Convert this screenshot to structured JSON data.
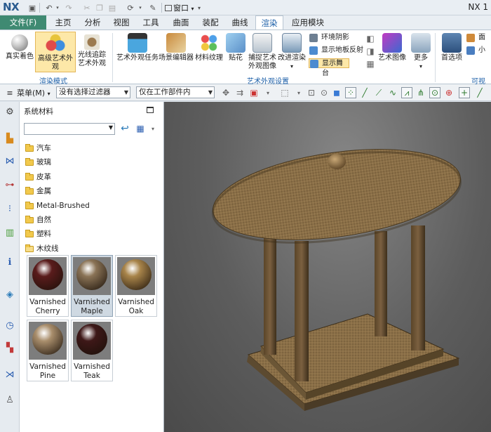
{
  "app": {
    "logo": "NX",
    "version_fragment": "NX 1"
  },
  "title_bar": {
    "window_menu": "窗口",
    "window_menu_arrow": "▾"
  },
  "tabs": {
    "file": "文件(F)",
    "items": [
      "主页",
      "分析",
      "视图",
      "工具",
      "曲面",
      "装配",
      "曲线",
      "渲染",
      "应用模块"
    ],
    "active": "渲染"
  },
  "ribbon": {
    "buttons": {
      "true_shading": "真实着色",
      "advanced_studio": "高级艺术外观",
      "raytrace_line1": "光线追踪",
      "raytrace_line2": "艺术外观",
      "studio_task": "艺术外观任务",
      "scene_editor": "场景编辑器",
      "material_texture": "材料纹理",
      "decal": "贴花",
      "capture_line1": "捕捉艺术",
      "capture_line2": "外观图像",
      "improve_line1": "改进渲染",
      "art_image": "艺术图像",
      "more": "更多",
      "preferences": "首选项",
      "face_partial": "面的",
      "plane_partial": "小平"
    },
    "small": {
      "ambient_shadow": "环境阴影",
      "floor_reflection": "显示地板反射",
      "show_stage": "显示舞台"
    },
    "groups": {
      "render_mode": "渲染模式",
      "studio_settings": "艺术外观设置",
      "visualization_partial": "可视化"
    }
  },
  "command_bar": {
    "menu": "菜单(M)",
    "selection_filter": "没有选择过滤器",
    "scope": "仅在工作部件内"
  },
  "navigator": {
    "title": "系统材料",
    "combo_value": "",
    "folders": [
      "汽车",
      "玻璃",
      "皮革",
      "金属",
      "Metal-Brushed",
      "自然",
      "塑料",
      "木纹线"
    ],
    "materials": [
      {
        "line1": "Varnished",
        "line2": "Cherry",
        "color": "#5a1c1c"
      },
      {
        "line1": "Varnished",
        "line2": "Maple",
        "color": "#8a7356"
      },
      {
        "line1": "Varnished",
        "line2": "Oak",
        "color": "#a8844a"
      },
      {
        "line1": "Varnished",
        "line2": "Pine",
        "color": "#a98e6c"
      },
      {
        "line1": "Varnished",
        "line2": "Teak",
        "color": "#3e1818"
      }
    ],
    "selected_material": "Varnished Maple"
  },
  "viewport": {
    "model": "gazebo",
    "material_color": "#8a6f47",
    "background": "#5d5d5d"
  },
  "colors": {
    "file_tab": "#3f8a72",
    "accent_blue": "#1c5fa8",
    "selected_bg": "#fde8a8"
  }
}
